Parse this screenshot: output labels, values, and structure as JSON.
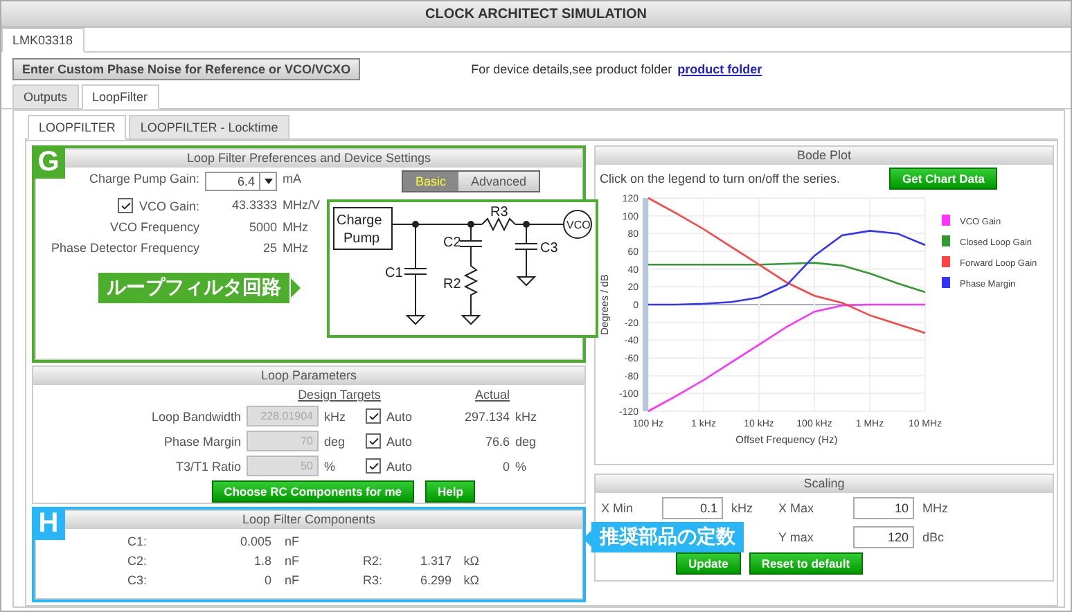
{
  "window": {
    "title": "CLOCK ARCHITECT SIMULATION"
  },
  "device_tabs": [
    {
      "label": "LMK03318",
      "selected": true
    }
  ],
  "custom_noise_button": "Enter Custom Phase Noise for Reference or VCO/VCXO",
  "device_note": {
    "text": "For device details,see product folder",
    "link": "product folder"
  },
  "main_tabs": [
    {
      "label": "Outputs",
      "selected": false
    },
    {
      "label": "LoopFilter",
      "selected": true
    }
  ],
  "sub_tabs": [
    {
      "label": "LOOPFILTER",
      "selected": true
    },
    {
      "label": "LOOPFILTER - Locktime",
      "selected": false
    }
  ],
  "preferences": {
    "title": "Loop Filter Preferences and Device Settings",
    "charge_pump_gain": {
      "label": "Charge Pump Gain:",
      "value": "6.4",
      "unit": "mA"
    },
    "mode_buttons": [
      {
        "label": "Basic",
        "selected": true
      },
      {
        "label": "Advanced",
        "selected": false
      }
    ],
    "vco_gain": {
      "label": "VCO Gain:",
      "checked": true,
      "value": "43.3333",
      "unit": "MHz/V"
    },
    "rows": [
      {
        "label": "VCO Frequency",
        "value": "5000",
        "unit": "MHz"
      },
      {
        "label": "Phase Detector Frequency",
        "value": "25",
        "unit": "MHz"
      }
    ],
    "circuit": {
      "source": "Charge Pump",
      "output": "VCO",
      "c1": "C1",
      "c2": "C2",
      "r2": "R2",
      "r3": "R3",
      "c3": "C3"
    }
  },
  "loop_parameters": {
    "title": "Loop Parameters",
    "target_heading": "Design Targets",
    "actual_heading": "Actual",
    "rows": [
      {
        "label": "Loop Bandwidth",
        "target": "228.01904",
        "unit": "kHz",
        "auto_label": "Auto",
        "auto": true,
        "actual": "297.134",
        "actual_unit": "kHz"
      },
      {
        "label": "Phase Margin",
        "target": "70",
        "unit": "deg",
        "auto_label": "Auto",
        "auto": true,
        "actual": "76.6",
        "actual_unit": "deg"
      },
      {
        "label": "T3/T1 Ratio",
        "target": "50",
        "unit": "%",
        "auto_label": "Auto",
        "auto": true,
        "actual": "0",
        "actual_unit": "%"
      }
    ],
    "buttons": [
      "Choose RC Components for me",
      "Help"
    ]
  },
  "components": {
    "title": "Loop Filter Components",
    "rows": [
      {
        "c": {
          "label": "C1:",
          "value": "0.005",
          "unit": "nF"
        }
      },
      {
        "c": {
          "label": "C2:",
          "value": "1.8",
          "unit": "nF"
        },
        "r": {
          "label": "R2:",
          "value": "1.317",
          "unit": "kΩ"
        }
      },
      {
        "c": {
          "label": "C3:",
          "value": "0",
          "unit": "nF"
        },
        "r": {
          "label": "R3:",
          "value": "6.299",
          "unit": "kΩ"
        }
      }
    ]
  },
  "bode_plot": {
    "title": "Bode Plot",
    "hint": "Click on the legend to turn on/off the series.",
    "button": "Get Chart Data",
    "chart_data": {
      "type": "line",
      "xlabel": "Offset Frequency (Hz)",
      "ylabel": "Degrees / dB",
      "categories": [
        "100 Hz",
        null,
        "1 kHz",
        null,
        "10 kHz",
        null,
        "100 kHz",
        null,
        "1 MHz",
        null,
        "10 MHz"
      ],
      "series": [
        {
          "name": "VCO Gain",
          "color": "#ff33ff",
          "values": [
            -120,
            -103,
            -85,
            -65,
            -45,
            -25,
            -8,
            -1,
            0,
            0,
            0
          ]
        },
        {
          "name": "Closed Loop Gain",
          "color": "#339933",
          "values": [
            45,
            45,
            45,
            45,
            45,
            46,
            47,
            44,
            35,
            24,
            14
          ]
        },
        {
          "name": "Forward Loop Gain",
          "color": "#ff4444",
          "values": [
            120,
            103,
            85,
            65,
            45,
            25,
            10,
            2,
            -12,
            -22,
            -32
          ]
        },
        {
          "name": "Phase Margin",
          "color": "#3333ff",
          "values": [
            0,
            0,
            1,
            3,
            8,
            22,
            55,
            78,
            83,
            80,
            67
          ]
        }
      ],
      "ylim": [
        -120,
        120
      ],
      "grid": true,
      "legend": true,
      "yticks": [
        -120,
        -100,
        -80,
        -60,
        -40,
        -20,
        0,
        20,
        40,
        60,
        80,
        100,
        120
      ]
    }
  },
  "scaling": {
    "title": "Scaling",
    "rows": [
      [
        {
          "label": "X Min",
          "value": "0.1",
          "unit": "kHz"
        },
        {
          "label": "X Max",
          "value": "10",
          "unit": "MHz"
        }
      ],
      [
        null,
        {
          "label": "Y max",
          "value": "120",
          "unit": "dBc"
        }
      ]
    ],
    "buttons": [
      "Update",
      "Reset to default"
    ]
  },
  "annotations": {
    "g_badge": "G",
    "circuit_callout": "ループフィルタ回路",
    "h_badge": "H",
    "components_callout": "推奨部品の定数"
  }
}
